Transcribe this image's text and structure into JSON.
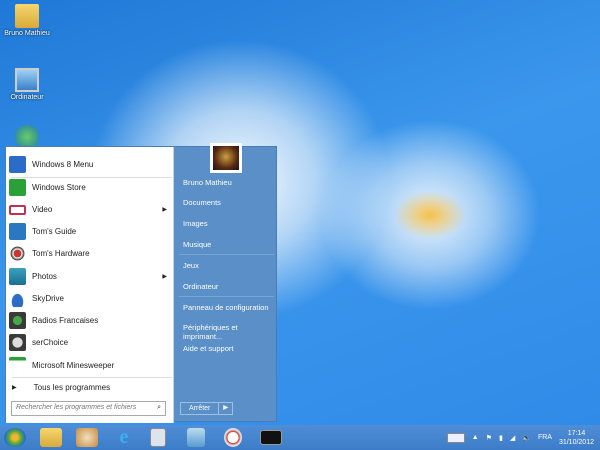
{
  "desktop": {
    "icons": [
      {
        "label": "Bruno Mathieu",
        "icon": "user-folder-icon"
      },
      {
        "label": "Ordinateur",
        "icon": "computer-icon"
      },
      {
        "label": "",
        "icon": "network-icon"
      }
    ]
  },
  "start_menu": {
    "programs": [
      {
        "label": "Windows 8 Menu",
        "icon": "windows8-menu-icon",
        "color": "#2a6cc8"
      },
      {
        "label": "Windows Store",
        "icon": "store-icon",
        "color": "#2aa138"
      },
      {
        "label": "Video",
        "icon": "video-icon",
        "color": "#ffffff",
        "submenu": true
      },
      {
        "label": "Tom's Guide",
        "icon": "toms-guide-icon",
        "color": "#2a78c0"
      },
      {
        "label": "Tom's Hardware",
        "icon": "toms-hardware-icon",
        "color": "#ffffff"
      },
      {
        "label": "Photos",
        "icon": "photos-icon",
        "color": "#2a90a8",
        "submenu": true
      },
      {
        "label": "SkyDrive",
        "icon": "skydrive-icon",
        "color": "#ffffff"
      },
      {
        "label": "Radios Francaises",
        "icon": "radio-icon",
        "color": "#3a3a3a"
      },
      {
        "label": "serChoice",
        "icon": "serchoice-icon",
        "color": "#3a3a3a"
      },
      {
        "label": "Microsoft Minesweeper",
        "icon": "minesweeper-icon",
        "color": "#ffffff"
      }
    ],
    "all_programs": "Tous les programmes",
    "search_placeholder": "Rechercher les programmes et fichiers",
    "right": [
      "Bruno Mathieu",
      "Documents",
      "Images",
      "Musique",
      "Jeux",
      "Ordinateur",
      "Panneau de configuration",
      "Périphériques et imprimant...",
      "Aide et support"
    ],
    "shutdown": "Arrêter"
  },
  "taskbar": {
    "apps": [
      "start-orb-icon",
      "file-explorer-icon",
      "paint-icon",
      "internet-explorer-icon",
      "calculator-icon",
      "notepad-icon",
      "snipping-tool-icon",
      "command-prompt-icon"
    ],
    "language": "FRA",
    "time": "17:14",
    "date": "31/10/2012"
  }
}
